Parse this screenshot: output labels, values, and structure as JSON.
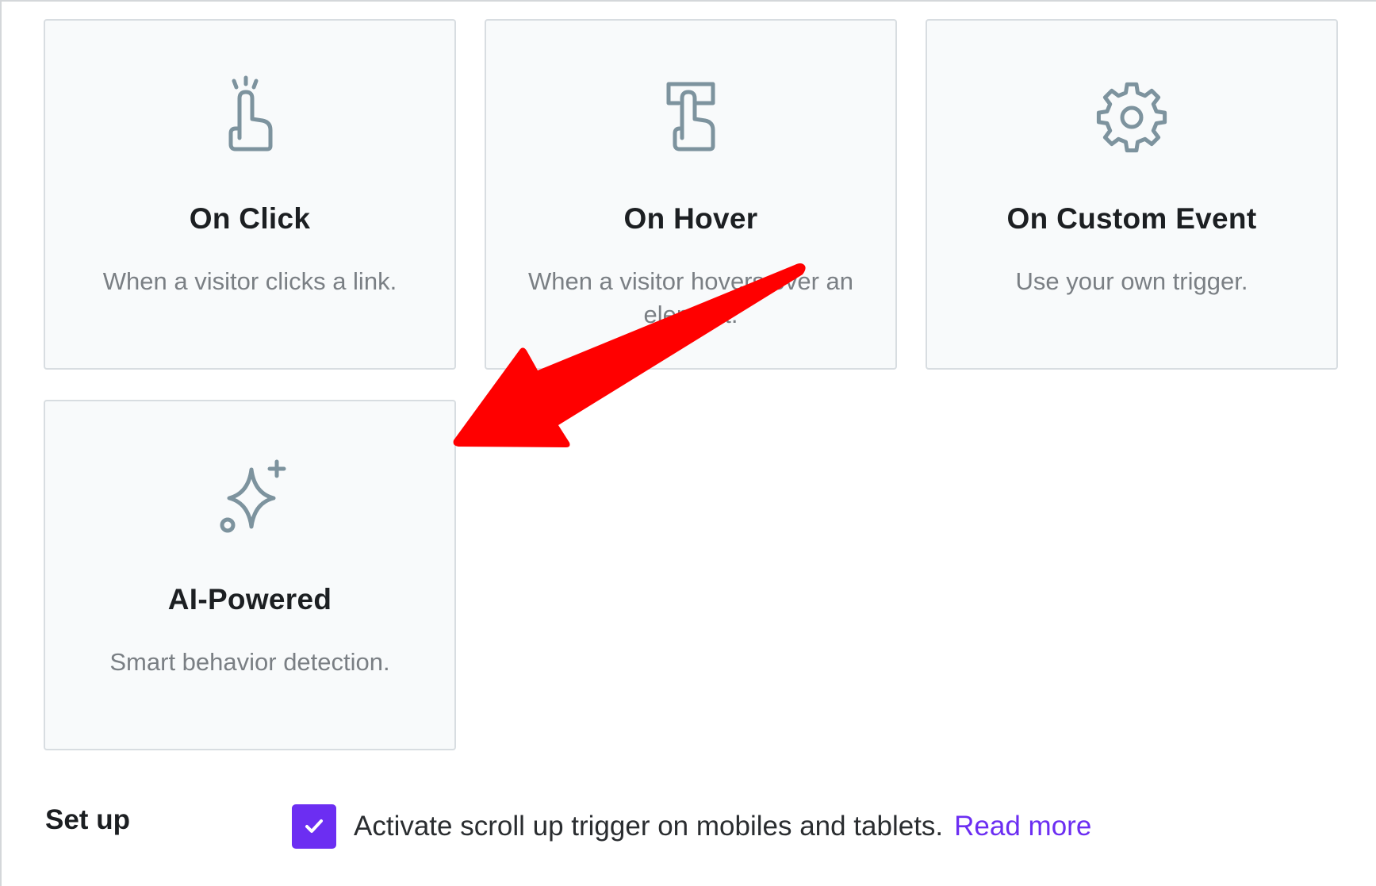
{
  "triggers": [
    {
      "id": "on-click",
      "icon": "pointer-click-icon",
      "title": "On Click",
      "description": "When a visitor clicks a link."
    },
    {
      "id": "on-hover",
      "icon": "pointer-hover-icon",
      "title": "On Hover",
      "description": "When a visitor hovers over an element."
    },
    {
      "id": "on-custom-event",
      "icon": "gear-icon",
      "title": "On Custom Event",
      "description": "Use your own trigger."
    },
    {
      "id": "ai-powered",
      "icon": "sparkle-icon",
      "title": "AI-Powered",
      "description": "Smart behavior detection."
    }
  ],
  "setup": {
    "label": "Set up",
    "checkbox_checked": true,
    "checkbox_label": "Activate scroll up trigger on mobiles and tablets.",
    "read_more": "Read more"
  },
  "colors": {
    "accent": "#6c2ef2",
    "icon": "#7d939e",
    "card_bg": "#f8fafb",
    "card_border": "#d8dde1",
    "annotation_arrow": "#ff0000"
  }
}
